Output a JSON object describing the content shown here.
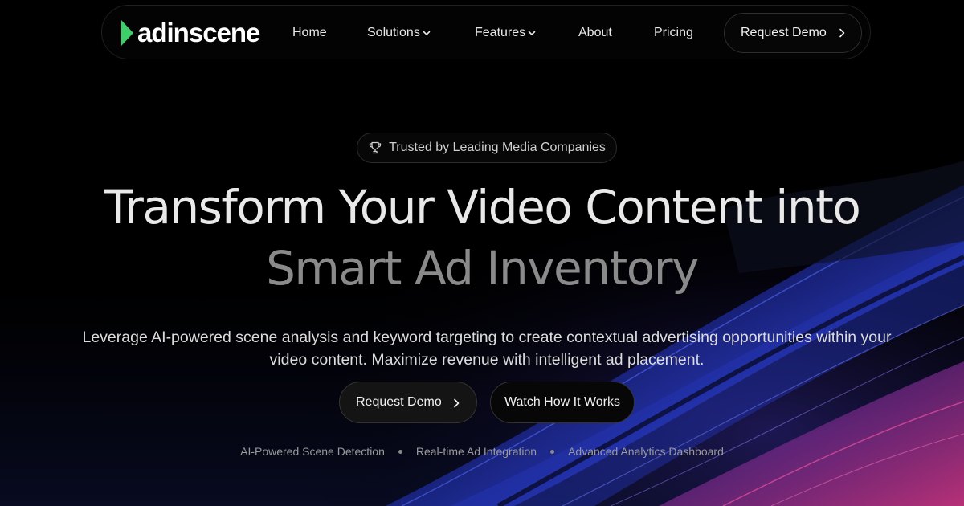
{
  "brand": {
    "name": "adinscene",
    "accent_color": "#3ecf6a",
    "icon": "play-triangle-icon"
  },
  "nav": {
    "items": [
      {
        "label": "Home",
        "has_dropdown": false
      },
      {
        "label": "Solutions",
        "has_dropdown": true
      },
      {
        "label": "Features",
        "has_dropdown": true
      },
      {
        "label": "About",
        "has_dropdown": false
      },
      {
        "label": "Pricing",
        "has_dropdown": false
      }
    ],
    "cta_label": "Request Demo",
    "cta_icon": "chevron-right-icon"
  },
  "hero": {
    "badge_icon": "trophy-icon",
    "badge_text": "Trusted by Leading Media Companies",
    "headline_line1": "Transform Your Video Content into",
    "headline_line2": "Smart Ad Inventory",
    "subtext": "Leverage AI-powered scene analysis and keyword targeting to create contextual advertising opportunities within your video content. Maximize revenue with intelligent ad placement.",
    "primary_button": "Request Demo",
    "secondary_button": "Watch How It Works",
    "features": [
      "AI-Powered Scene Detection",
      "Real-time Ad Integration",
      "Advanced Analytics Dashboard"
    ]
  },
  "colors": {
    "background": "#000000",
    "wave_blue": "#2a3fb0",
    "wave_magenta": "#b0306e"
  }
}
